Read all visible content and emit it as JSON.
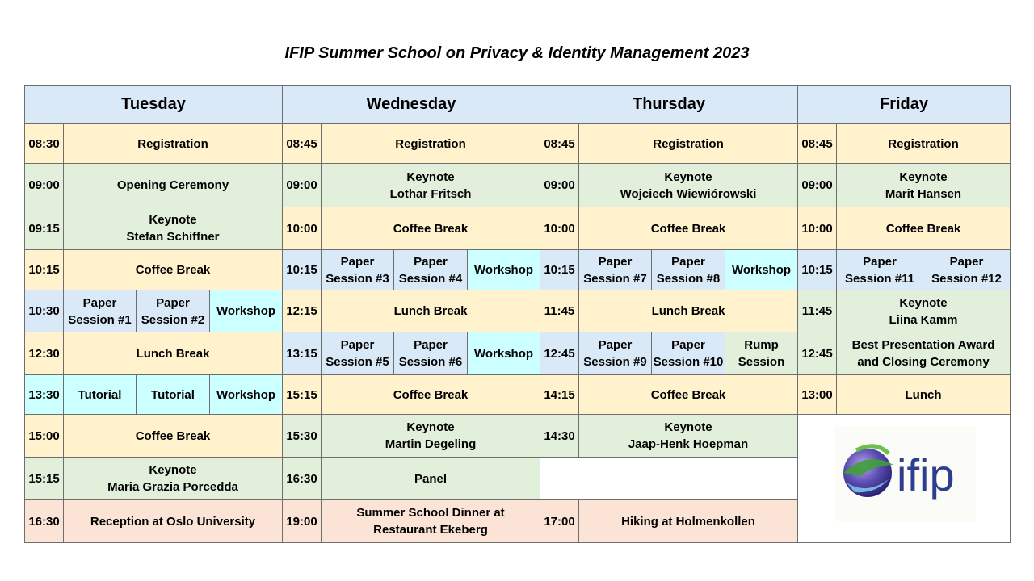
{
  "title": "IFIP Summer School on Privacy & Identity Management 2023",
  "days": [
    {
      "name": "Tuesday",
      "rows": [
        {
          "time": "08:30",
          "items": [
            {
              "lines": [
                "Registration"
              ],
              "kind": "y"
            }
          ]
        },
        {
          "time": "09:00",
          "items": [
            {
              "lines": [
                "Opening Ceremony"
              ],
              "kind": "g"
            }
          ]
        },
        {
          "time": "09:15",
          "items": [
            {
              "lines": [
                "Keynote",
                "Stefan Schiffner"
              ],
              "kind": "g"
            }
          ]
        },
        {
          "time": "10:15",
          "items": [
            {
              "lines": [
                "Coffee Break"
              ],
              "kind": "y"
            }
          ]
        },
        {
          "time": "10:30",
          "items": [
            {
              "lines": [
                "Paper",
                "Session #1"
              ],
              "kind": "b"
            },
            {
              "lines": [
                "Paper",
                "Session #2"
              ],
              "kind": "b"
            },
            {
              "lines": [
                "Workshop"
              ],
              "kind": "c"
            }
          ]
        },
        {
          "time": "12:30",
          "items": [
            {
              "lines": [
                "Lunch Break"
              ],
              "kind": "y"
            }
          ]
        },
        {
          "time": "13:30",
          "items": [
            {
              "lines": [
                "Tutorial"
              ],
              "kind": "c"
            },
            {
              "lines": [
                "Tutorial"
              ],
              "kind": "c"
            },
            {
              "lines": [
                "Workshop"
              ],
              "kind": "c"
            }
          ]
        },
        {
          "time": "15:00",
          "items": [
            {
              "lines": [
                "Coffee Break"
              ],
              "kind": "y"
            }
          ]
        },
        {
          "time": "15:15",
          "items": [
            {
              "lines": [
                "Keynote",
                "Maria Grazia Porcedda"
              ],
              "kind": "g"
            }
          ]
        },
        {
          "time": "16:30",
          "items": [
            {
              "lines": [
                "Reception at Oslo University"
              ],
              "kind": "p"
            }
          ]
        }
      ]
    },
    {
      "name": "Wednesday",
      "rows": [
        {
          "time": "08:45",
          "items": [
            {
              "lines": [
                "Registration"
              ],
              "kind": "y"
            }
          ]
        },
        {
          "time": "09:00",
          "items": [
            {
              "lines": [
                "Keynote",
                "Lothar Fritsch"
              ],
              "kind": "g"
            }
          ]
        },
        {
          "time": "10:00",
          "items": [
            {
              "lines": [
                "Coffee Break"
              ],
              "kind": "y"
            }
          ]
        },
        {
          "time": "10:15",
          "items": [
            {
              "lines": [
                "Paper",
                "Session #3"
              ],
              "kind": "b"
            },
            {
              "lines": [
                "Paper",
                "Session #4"
              ],
              "kind": "b"
            },
            {
              "lines": [
                "Workshop"
              ],
              "kind": "c"
            }
          ]
        },
        {
          "time": "12:15",
          "items": [
            {
              "lines": [
                "Lunch Break"
              ],
              "kind": "y"
            }
          ]
        },
        {
          "time": "13:15",
          "items": [
            {
              "lines": [
                "Paper",
                "Session #5"
              ],
              "kind": "b"
            },
            {
              "lines": [
                "Paper",
                "Session #6"
              ],
              "kind": "b"
            },
            {
              "lines": [
                "Workshop"
              ],
              "kind": "c"
            }
          ]
        },
        {
          "time": "15:15",
          "items": [
            {
              "lines": [
                "Coffee Break"
              ],
              "kind": "y"
            }
          ]
        },
        {
          "time": "15:30",
          "items": [
            {
              "lines": [
                "Keynote",
                "Martin Degeling"
              ],
              "kind": "g"
            }
          ]
        },
        {
          "time": "16:30",
          "items": [
            {
              "lines": [
                "Panel"
              ],
              "kind": "g"
            }
          ]
        },
        {
          "time": "19:00",
          "items": [
            {
              "lines": [
                "Summer School Dinner at",
                "Restaurant Ekeberg"
              ],
              "kind": "p"
            }
          ]
        }
      ]
    },
    {
      "name": "Thursday",
      "rows": [
        {
          "time": "08:45",
          "items": [
            {
              "lines": [
                "Registration"
              ],
              "kind": "y"
            }
          ]
        },
        {
          "time": "09:00",
          "items": [
            {
              "lines": [
                "Keynote",
                "Wojciech Wiewiórowski"
              ],
              "kind": "g"
            }
          ]
        },
        {
          "time": "10:00",
          "items": [
            {
              "lines": [
                "Coffee Break"
              ],
              "kind": "y"
            }
          ]
        },
        {
          "time": "10:15",
          "items": [
            {
              "lines": [
                "Paper",
                "Session #7"
              ],
              "kind": "b"
            },
            {
              "lines": [
                "Paper",
                "Session #8"
              ],
              "kind": "b"
            },
            {
              "lines": [
                "Workshop"
              ],
              "kind": "c"
            }
          ]
        },
        {
          "time": "11:45",
          "items": [
            {
              "lines": [
                "Lunch Break"
              ],
              "kind": "y"
            }
          ]
        },
        {
          "time": "12:45",
          "items": [
            {
              "lines": [
                "Paper",
                "Session #9"
              ],
              "kind": "b"
            },
            {
              "lines": [
                "Paper",
                "Session #10"
              ],
              "kind": "b"
            },
            {
              "lines": [
                "Rump",
                "Session"
              ],
              "kind": "g"
            }
          ]
        },
        {
          "time": "14:15",
          "items": [
            {
              "lines": [
                "Coffee Break"
              ],
              "kind": "y"
            }
          ]
        },
        {
          "time": "14:30",
          "items": [
            {
              "lines": [
                "Keynote",
                "Jaap-Henk Hoepman"
              ],
              "kind": "g"
            }
          ]
        },
        {
          "time": "",
          "items": [
            {
              "lines": [],
              "kind": "w"
            }
          ]
        },
        {
          "time": "17:00",
          "items": [
            {
              "lines": [
                "Hiking at Holmenkollen"
              ],
              "kind": "p"
            }
          ]
        }
      ]
    },
    {
      "name": "Friday",
      "rows": [
        {
          "time": "08:45",
          "items": [
            {
              "lines": [
                "Registration"
              ],
              "kind": "y"
            }
          ]
        },
        {
          "time": "09:00",
          "items": [
            {
              "lines": [
                "Keynote",
                "Marit Hansen"
              ],
              "kind": "g"
            }
          ]
        },
        {
          "time": "10:00",
          "items": [
            {
              "lines": [
                "Coffee Break"
              ],
              "kind": "y"
            }
          ]
        },
        {
          "time": "10:15",
          "items": [
            {
              "lines": [
                "Paper",
                "Session #11"
              ],
              "kind": "b"
            },
            {
              "lines": [
                "Paper",
                "Session #12"
              ],
              "kind": "b"
            }
          ]
        },
        {
          "time": "11:45",
          "items": [
            {
              "lines": [
                "Keynote",
                "Liina Kamm"
              ],
              "kind": "g"
            }
          ]
        },
        {
          "time": "12:45",
          "items": [
            {
              "lines": [
                "Best Presentation Award",
                "and Closing Ceremony"
              ],
              "kind": "g"
            }
          ]
        },
        {
          "time": "13:00",
          "items": [
            {
              "lines": [
                "Lunch"
              ],
              "kind": "y"
            }
          ]
        }
      ]
    }
  ],
  "logo": {
    "text": "ifip",
    "icon": "ifip-globe-icon",
    "color": "#2e3e8f"
  }
}
